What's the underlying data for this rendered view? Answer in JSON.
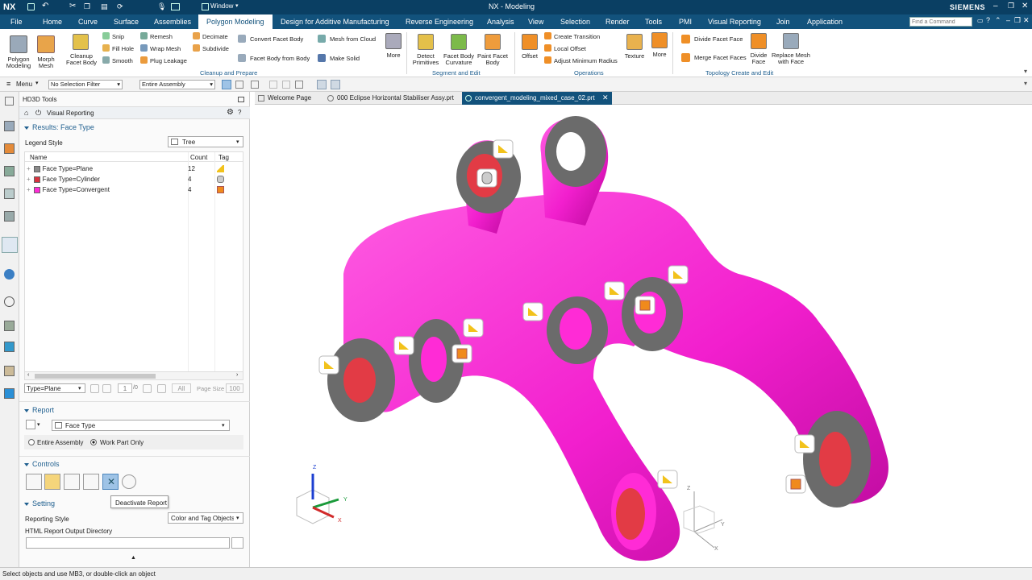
{
  "app": {
    "logo": "NX",
    "window_menu": "Window",
    "title": "NX - Modeling",
    "brand": "SIEMENS",
    "search_placeholder": "Find a Command"
  },
  "menu": [
    "File",
    "Home",
    "Curve",
    "Surface",
    "Assemblies",
    "Polygon Modeling",
    "Design for Additive Manufacturing",
    "Reverse Engineering",
    "Analysis",
    "View",
    "Selection",
    "Render",
    "Tools",
    "PMI",
    "Visual Reporting",
    "Join",
    "Application"
  ],
  "active_tab": "Polygon Modeling",
  "ribbon": {
    "polygon_modeling": "Polygon Modeling",
    "morph_mesh": "Morph Mesh",
    "cleanup_facet_body": "Cleanup Facet Body",
    "snip": "Snip",
    "fill_hole": "Fill Hole",
    "smooth": "Smooth",
    "remesh": "Remesh",
    "wrap_mesh": "Wrap Mesh",
    "plug_leakage": "Plug Leakage",
    "decimate": "Decimate",
    "subdivide": "Subdivide",
    "convert_facet_body": "Convert Facet Body",
    "facet_body_from_body": "Facet Body from Body",
    "mesh_from_cloud": "Mesh from Cloud",
    "make_solid": "Make Solid",
    "more": "More",
    "grp_cleanup": "Cleanup and Prepare",
    "detect_primitives": "Detect Primitives",
    "facet_body_curvature": "Facet Body Curvature",
    "paint_facet_body": "Paint Facet Body",
    "grp_segment": "Segment and Edit",
    "offset": "Offset",
    "create_transition": "Create Transition",
    "local_offset": "Local Offset",
    "adjust_min_radius": "Adjust Minimum Radius",
    "texture": "Texture",
    "more2": "More",
    "grp_operations": "Operations",
    "divide_facet_face": "Divide Facet Face",
    "merge_facet_faces": "Merge Facet Faces",
    "divide_face": "Divide Face",
    "replace_mesh": "Replace Mesh with Face",
    "grp_topology": "Topology Create and Edit"
  },
  "selection_bar": {
    "menu": "Menu",
    "filter": "No Selection Filter",
    "scope": "Entire Assembly"
  },
  "panel": {
    "title": "HD3D Tools",
    "subtitle": "Visual Reporting",
    "results_title": "Results: Face Type",
    "legend_style_label": "Legend Style",
    "legend_style_value": "Tree",
    "columns": {
      "name": "Name",
      "count": "Count",
      "tag": "Tag"
    },
    "rows": [
      {
        "name": "Face Type=Plane",
        "count": "12",
        "color": "#8a8a8a"
      },
      {
        "name": "Face Type=Cylinder",
        "count": "4",
        "color": "#d8333f"
      },
      {
        "name": "Face Type=Convergent",
        "count": "4",
        "color": "#ff2bd6"
      }
    ],
    "page_filter": "Type=Plane",
    "page_num": "1",
    "page_of": "/0",
    "page_all": "All",
    "page_size_label": "Page Size",
    "page_size": "100",
    "report_title": "Report",
    "report_value": "Face Type",
    "radio_entire": "Entire Assembly",
    "radio_work": "Work Part Only",
    "controls_title": "Controls",
    "tooltip": "Deactivate Report",
    "setting_title": "Setting",
    "reporting_style_label": "Reporting Style",
    "reporting_style_value": "Color and Tag Objects",
    "html_dir_label": "HTML Report Output Directory"
  },
  "tabs": [
    "Welcome Page",
    "000 Eclipse Horizontal Stabiliser Assy.prt",
    "convergent_modeling_mixed_case_02.prt"
  ],
  "axes": {
    "z": "Z",
    "y": "Y",
    "x": "X"
  },
  "status": "Select objects and use MB3, or double-click an object",
  "colors": {
    "title_bar": "#0a3f63",
    "menu_bar": "#12527c",
    "model": "#ff2bd6",
    "plane": "#8a8a8a",
    "cylinder": "#e23b45",
    "accent": "#1f5f8f"
  }
}
